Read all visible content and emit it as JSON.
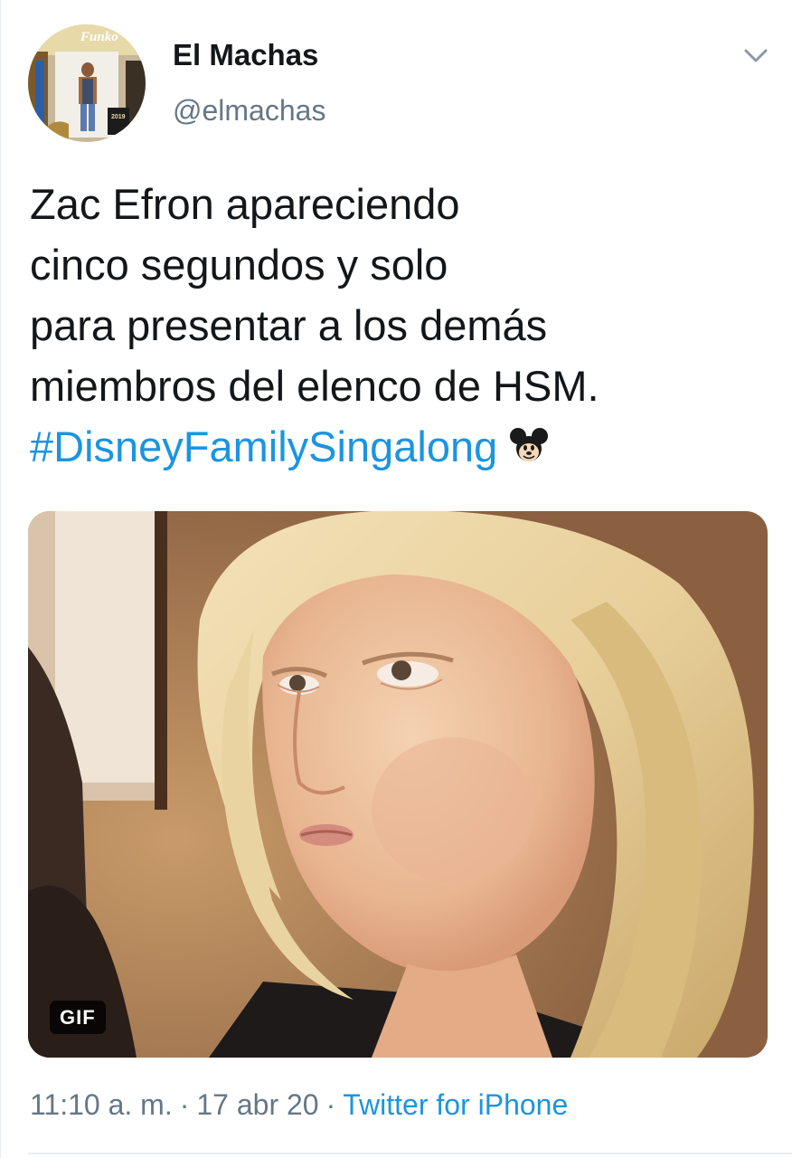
{
  "tweet": {
    "author": {
      "display_name": "El Machas",
      "handle": "@elmachas",
      "avatar_text": "Funko",
      "avatar_badge": "2019"
    },
    "menu_icon": "chevron-down-icon",
    "text_lines": [
      "Zac Efron apareciendo",
      "cinco segundos y solo",
      "para presentar a los demás",
      "miembros del elenco de HSM."
    ],
    "hashtag": "#DisneyFamilySingalong",
    "emoji": "mouse-face-emoji",
    "media": {
      "type": "gif",
      "badge": "GIF"
    },
    "time": "11:10 a. m.",
    "separator": "·",
    "date": "17 abr 20",
    "source": "Twitter for iPhone"
  },
  "colors": {
    "text": "#14171a",
    "secondary": "#657786",
    "link": "#1b95e0",
    "divider": "#e6ecf0"
  }
}
